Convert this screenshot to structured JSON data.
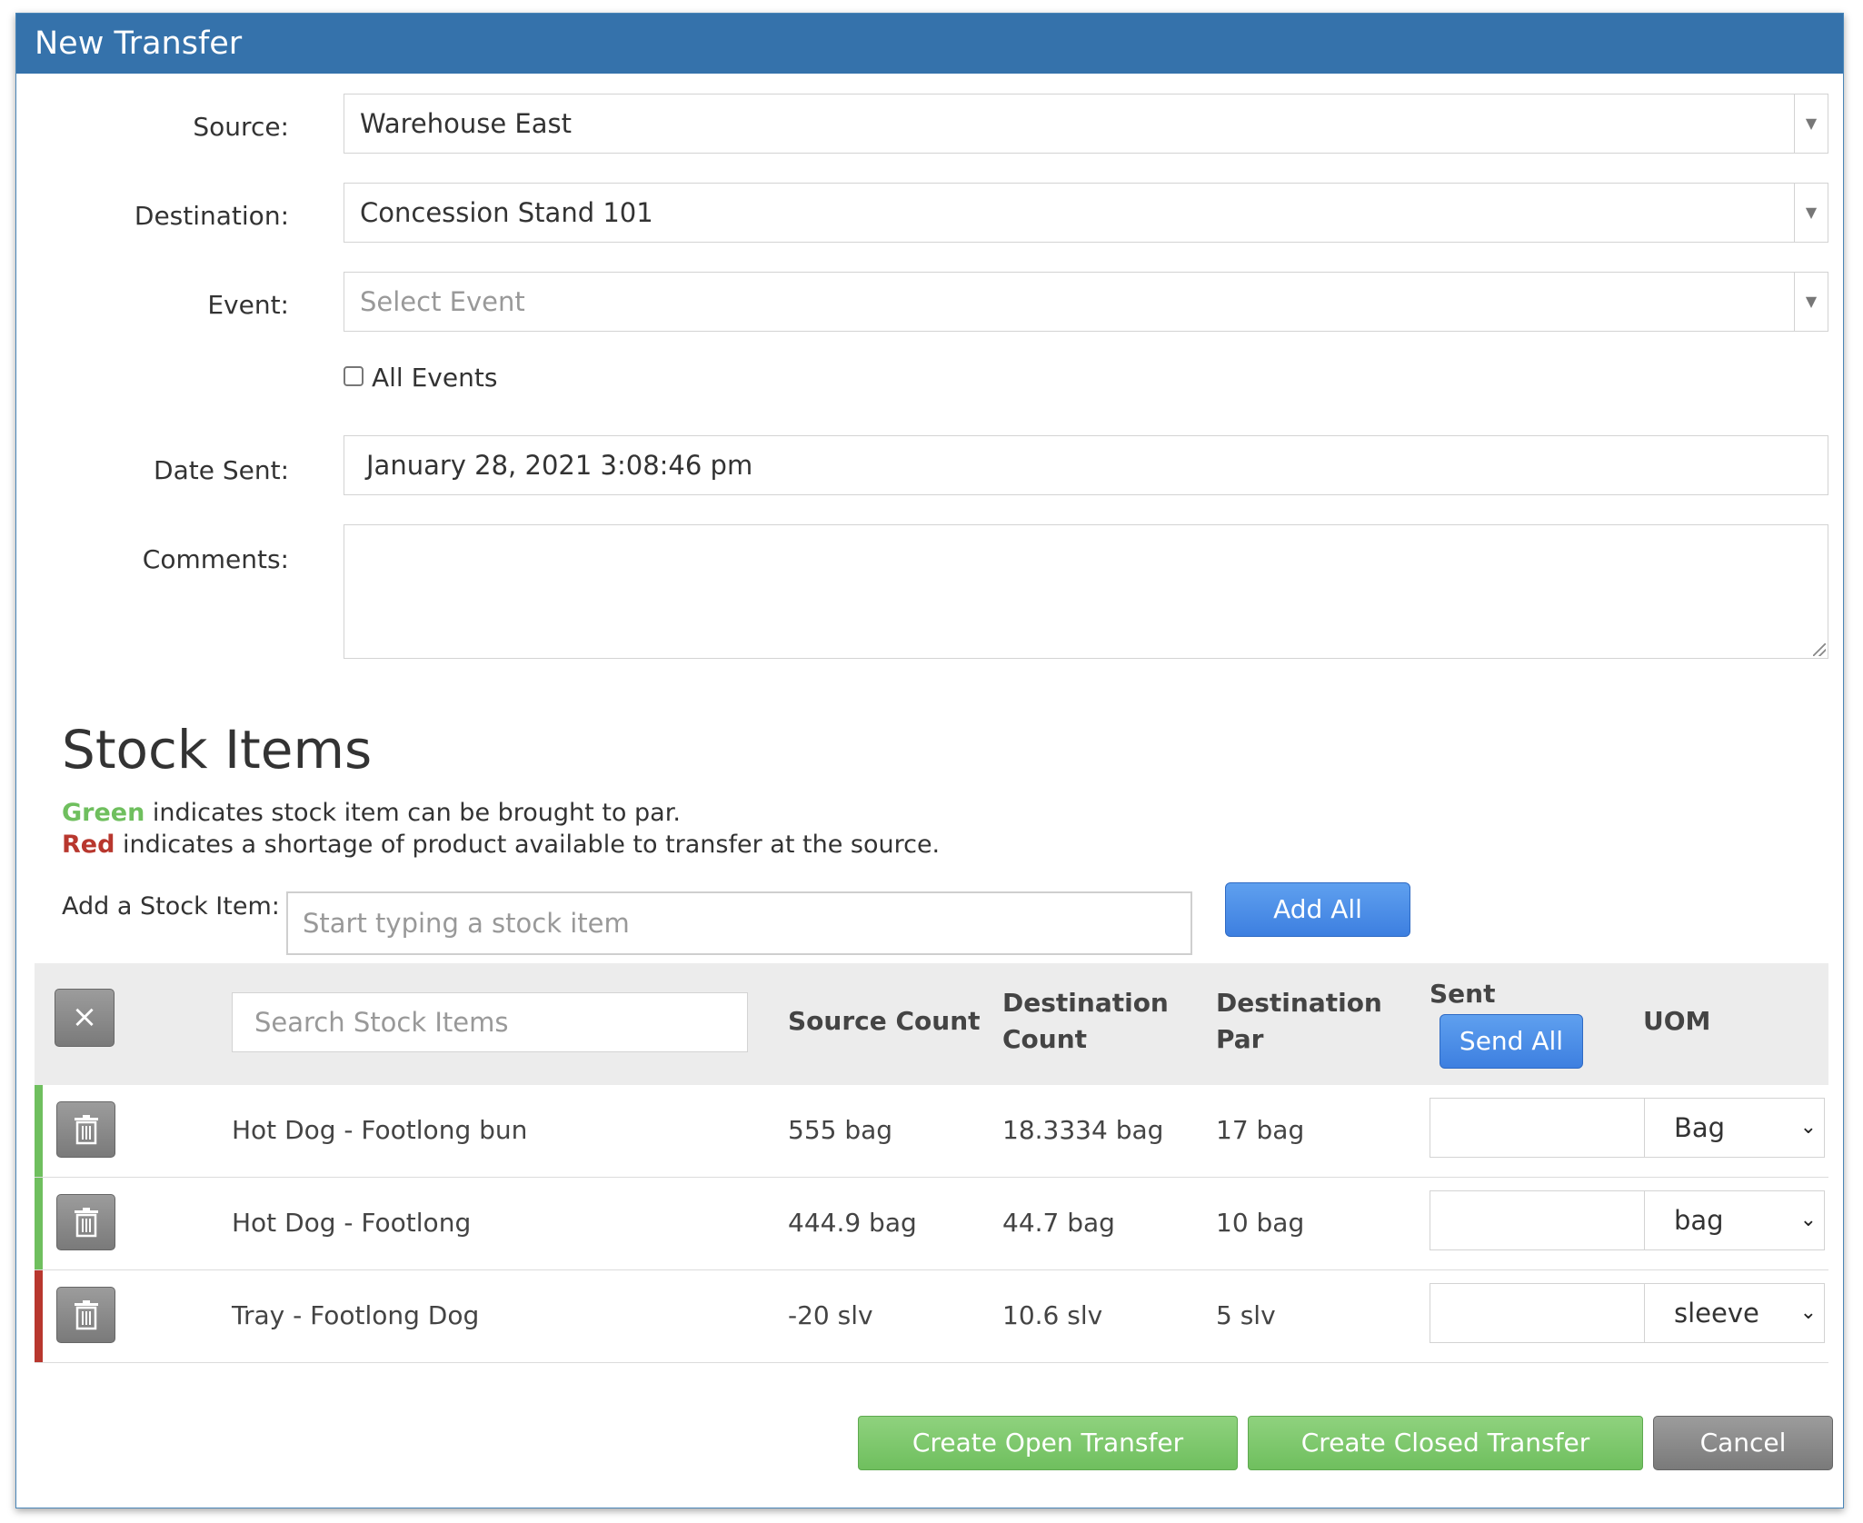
{
  "window": {
    "title": "New Transfer"
  },
  "form": {
    "source": {
      "label": "Source:",
      "value": "Warehouse East"
    },
    "destination": {
      "label": "Destination:",
      "value": "Concession Stand 101"
    },
    "event": {
      "label": "Event:",
      "placeholder": "Select Event"
    },
    "all_events": {
      "label": "All Events",
      "checked": false
    },
    "date_sent": {
      "label": "Date Sent:",
      "value": "January 28, 2021 3:08:46 pm"
    },
    "comments": {
      "label": "Comments:",
      "value": ""
    }
  },
  "stock": {
    "heading": "Stock Items",
    "legend": {
      "green_word": "Green",
      "green_text": " indicates stock item can be brought to par.",
      "red_word": "Red",
      "red_text": " indicates a shortage of product available to transfer at the source.",
      "green_color": "#6fbf5e",
      "red_color": "#b8372e"
    },
    "add_label": "Add a Stock Item:",
    "add_placeholder": "Start typing a stock item",
    "add_all": "Add All",
    "search_placeholder": "Search Stock Items",
    "columns": {
      "source_count": "Source Count",
      "destination_count_1": "Destination",
      "destination_count_2": "Count",
      "destination_par_1": "Destination",
      "destination_par_2": "Par",
      "sent": "Sent",
      "uom": "UOM"
    },
    "send_all": "Send All",
    "clear_icon": "×",
    "rows": [
      {
        "name": "Hot Dog - Footlong bun",
        "source": "555 bag",
        "dest_count": "18.3334 bag",
        "dest_par": "17 bag",
        "sent": "",
        "uom": "Bag",
        "status": "green"
      },
      {
        "name": "Hot Dog - Footlong",
        "source": "444.9 bag",
        "dest_count": "44.7 bag",
        "dest_par": "10 bag",
        "sent": "",
        "uom": "bag",
        "status": "green"
      },
      {
        "name": "Tray - Footlong Dog",
        "source": "-20 slv",
        "dest_count": "10.6 slv",
        "dest_par": "5 slv",
        "sent": "",
        "uom": "sleeve",
        "status": "red"
      }
    ]
  },
  "actions": {
    "create_open": "Create Open Transfer",
    "create_closed": "Create Closed Transfer",
    "cancel": "Cancel"
  }
}
